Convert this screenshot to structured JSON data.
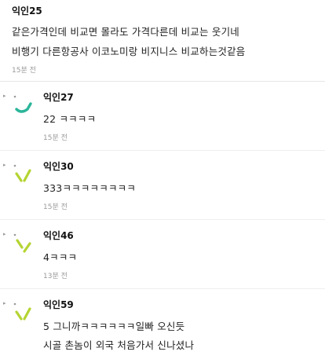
{
  "colors": {
    "text": "#222222",
    "time": "#9a9a9a",
    "divider": "#e6e6e6",
    "avatar_teal": "#2bb59a",
    "avatar_lime": "#b4d432",
    "avatar_dot": "#9a9a9a"
  },
  "top_comment": {
    "author": "익인25",
    "line1": "같은가격인데 비교면 몰라도 가격다른데 비교는 웃기네",
    "line2": "비행기 다른항공사 이코노미랑 비지니스 비교하는것같음",
    "time": "15분 전"
  },
  "replies": [
    {
      "avatar_icon": "teal-arc-avatar-icon",
      "author": "익인27",
      "line1": "22 ㅋㅋㅋㅋ",
      "line2": "",
      "time": "15분 전"
    },
    {
      "avatar_icon": "lime-check-avatar-icon",
      "author": "익인30",
      "line1": "333ㅋㅋㅋㅋㅋㅋㅋㅋ",
      "line2": "",
      "time": "15분 전"
    },
    {
      "avatar_icon": "lime-slash-avatar-icon",
      "author": "익인46",
      "line1": "4ㅋㅋㅋ",
      "line2": "",
      "time": "13분 전"
    },
    {
      "avatar_icon": "lime-check-avatar-icon",
      "author": "익인59",
      "line1": "5 그니까ㅋㅋㅋㅋㅋㅋ일빠 오신듯",
      "line2": "시골 촌놈이 외국 처음가서 신나셨나",
      "time": ""
    }
  ]
}
